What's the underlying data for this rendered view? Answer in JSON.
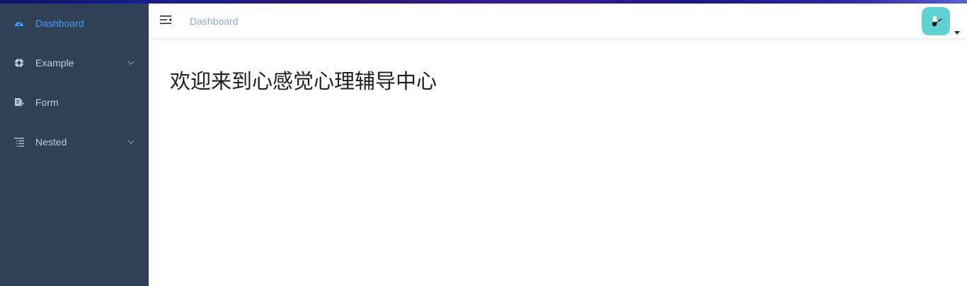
{
  "sidebar": {
    "items": [
      {
        "label": "Dashboard",
        "icon": "dashboard-icon",
        "active": true,
        "has_children": false
      },
      {
        "label": "Example",
        "icon": "example-icon",
        "active": false,
        "has_children": true
      },
      {
        "label": "Form",
        "icon": "form-icon",
        "active": false,
        "has_children": false
      },
      {
        "label": "Nested",
        "icon": "nested-icon",
        "active": false,
        "has_children": true
      }
    ]
  },
  "navbar": {
    "breadcrumb": "Dashboard",
    "toggle_icon": "hamburger-icon",
    "avatar_icon": "avatar-image",
    "dropdown_icon": "caret-down-icon"
  },
  "main": {
    "welcome_text": "欢迎来到心感觉心理辅导中心"
  },
  "colors": {
    "sidebar_bg": "#304156",
    "sidebar_text": "#bfcbd9",
    "active_text": "#409eff",
    "breadcrumb_text": "#97a8be",
    "avatar_bg": "#5fd3d1"
  }
}
